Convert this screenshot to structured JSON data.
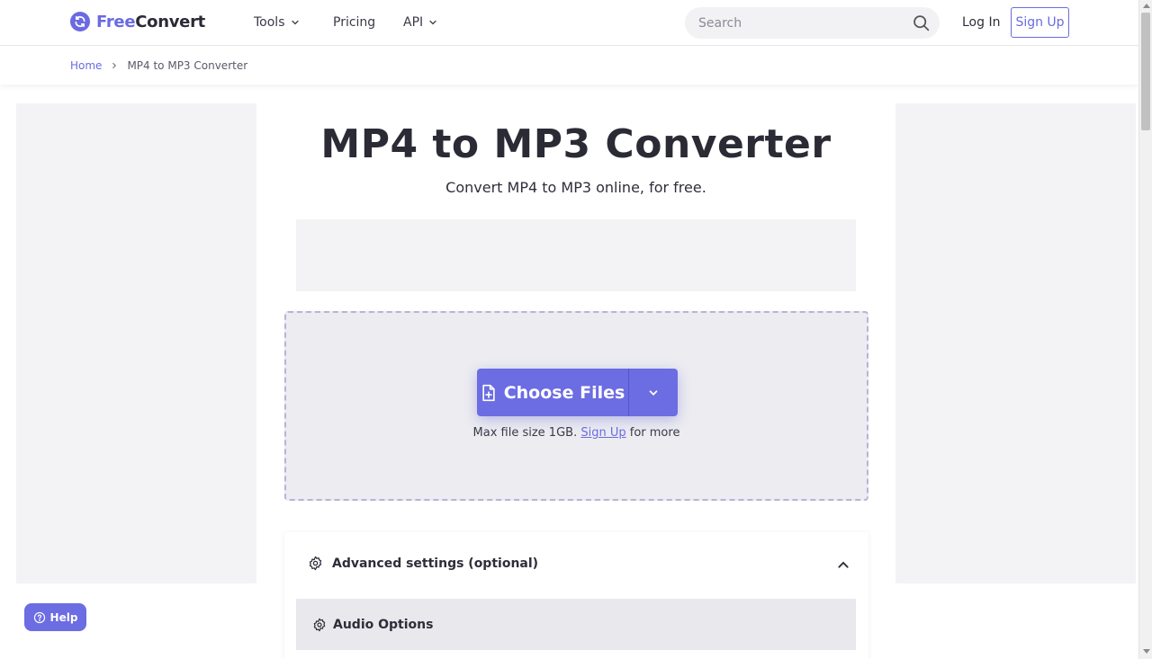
{
  "header": {
    "logo": {
      "free": "Free",
      "convert": "Convert",
      "icon": "refresh-icon"
    },
    "nav": [
      {
        "label": "Tools",
        "has_dropdown": true
      },
      {
        "label": "Pricing",
        "has_dropdown": false
      },
      {
        "label": "API",
        "has_dropdown": true
      }
    ],
    "search": {
      "placeholder": "Search",
      "icon": "search-icon"
    },
    "login_label": "Log In",
    "signup_label": "Sign Up"
  },
  "breadcrumb": {
    "home": "Home",
    "current": "MP4 to MP3 Converter"
  },
  "main": {
    "title": "MP4 to MP3 Converter",
    "subtitle": "Convert MP4 to MP3 online, for free.",
    "upload": {
      "choose_label": "Choose Files",
      "max_prefix": "Max file size 1GB.",
      "signup_link": "Sign Up",
      "max_suffix": "for more"
    },
    "settings": {
      "title": "Advanced settings (optional)",
      "audio_options": "Audio Options"
    }
  },
  "help_label": "Help",
  "colors": {
    "accent": "#6c6ce3",
    "dropzone_bg": "#ececf1",
    "dropzone_border": "#b8b3d8",
    "ad_bg": "#f3f3f5"
  }
}
